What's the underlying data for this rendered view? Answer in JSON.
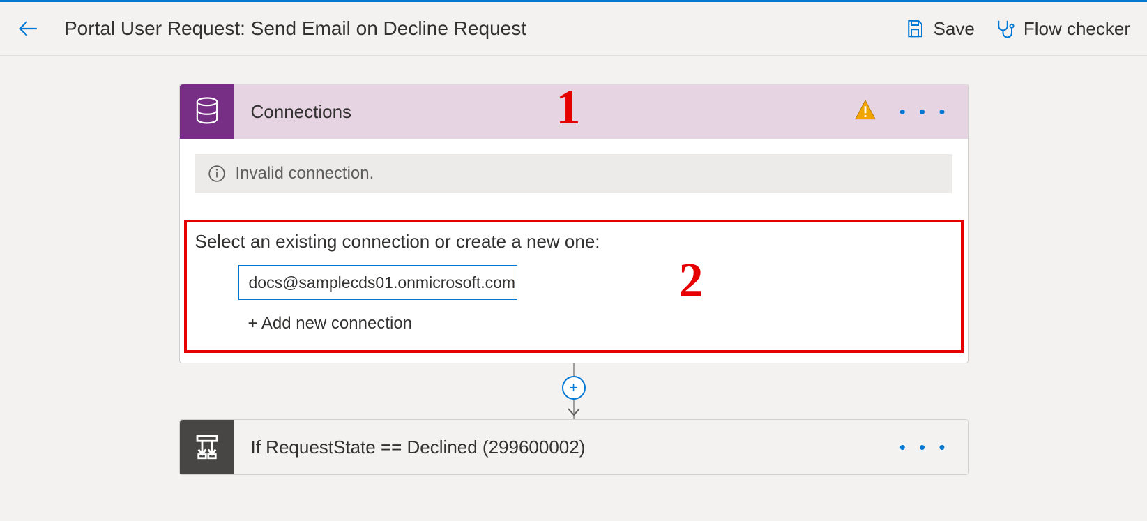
{
  "header": {
    "title": "Portal User Request: Send Email on Decline Request",
    "save_label": "Save",
    "flow_checker_label": "Flow checker"
  },
  "card_connections": {
    "title": "Connections",
    "error_msg": "Invalid connection.",
    "prompt": "Select an existing connection or create a new one:",
    "option_email": "docs@samplecds01.onmicrosoft.com",
    "add_new_label": "+ Add new connection"
  },
  "card_condition": {
    "title": "If RequestState == Declined (299600002)"
  },
  "annotations": {
    "one": "1",
    "two": "2"
  },
  "icons": {
    "more": "• • •",
    "plus": "+"
  }
}
